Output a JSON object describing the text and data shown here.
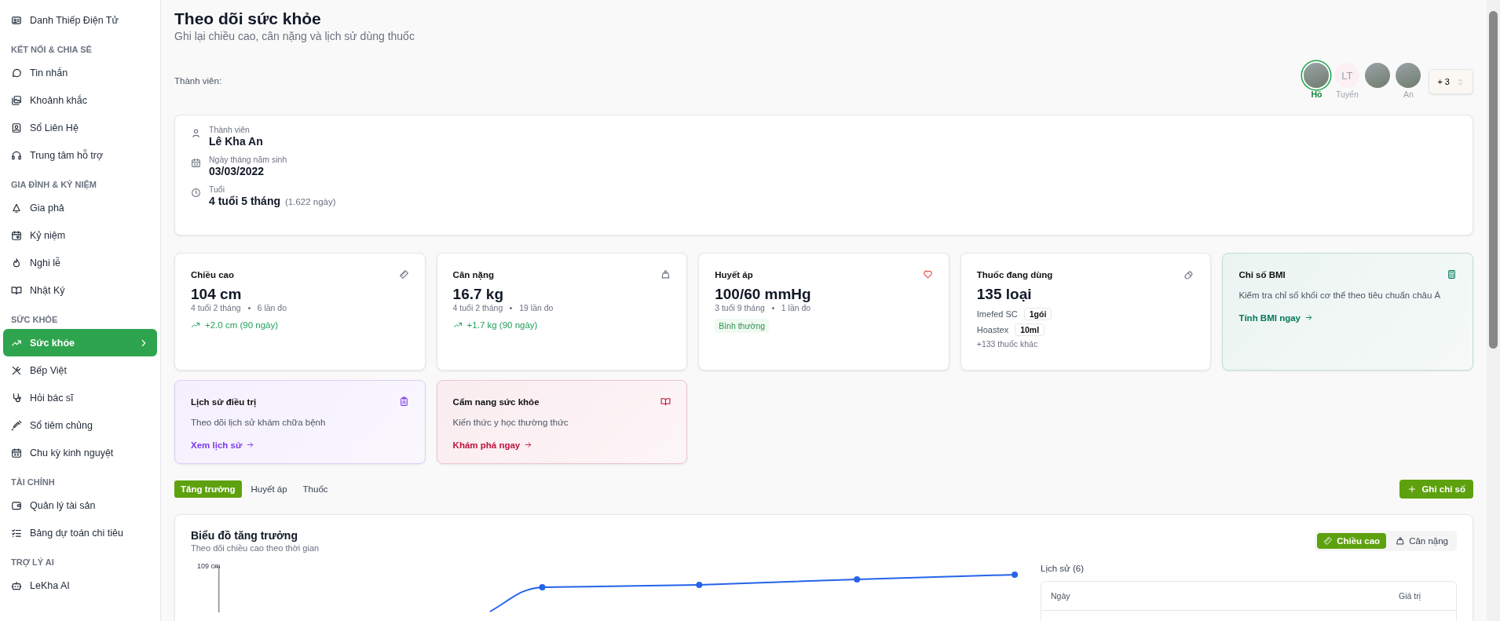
{
  "sidebar": {
    "sections": [
      {
        "items": [
          {
            "label": "Danh Thiếp Điện Tử",
            "selected": false
          }
        ]
      },
      {
        "title": "KẾT NỐI & CHIA SẺ",
        "items": [
          {
            "label": "Tin nhắn",
            "selected": false
          },
          {
            "label": "Khoảnh khắc",
            "selected": false
          },
          {
            "label": "Sổ Liên Hệ",
            "selected": false
          },
          {
            "label": "Trung tâm hỗ trợ",
            "selected": false
          }
        ]
      },
      {
        "title": "GIA ĐÌNH & KỶ NIỆM",
        "items": [
          {
            "label": "Gia phả",
            "selected": false
          },
          {
            "label": "Kỷ niệm",
            "selected": false
          },
          {
            "label": "Nghi lễ",
            "selected": false
          },
          {
            "label": "Nhật Ký",
            "selected": false
          }
        ]
      },
      {
        "title": "SỨC KHỎE",
        "items": [
          {
            "label": "Sức khỏe",
            "selected": true
          },
          {
            "label": "Bếp Việt",
            "selected": false
          },
          {
            "label": "Hỏi bác sĩ",
            "selected": false
          },
          {
            "label": "Sổ tiêm chủng",
            "selected": false
          },
          {
            "label": "Chu kỳ kinh nguyệt",
            "selected": false
          }
        ]
      },
      {
        "title": "TÀI CHÍNH",
        "items": [
          {
            "label": "Quản lý tài sản",
            "selected": false
          },
          {
            "label": "Bảng dự toán chi tiêu",
            "selected": false
          }
        ]
      },
      {
        "title": "TRỢ LÝ AI",
        "items": [
          {
            "label": "LeKha AI",
            "selected": false
          }
        ]
      }
    ]
  },
  "header": {
    "title": "Theo dõi sức khỏe",
    "subtitle": "Ghi lại chiều cao, cân nặng và lịch sử dùng thuốc"
  },
  "members": {
    "label": "Thành viên:",
    "items": [
      {
        "kind": "photo",
        "name": "Hồ",
        "selected": true
      },
      {
        "kind": "initials",
        "initials": "LT",
        "name": "Tuyến",
        "selected": false
      },
      {
        "kind": "photo",
        "selected": false
      },
      {
        "kind": "photo",
        "name": "An",
        "selected": false
      }
    ],
    "more": "+ 3"
  },
  "profile": [
    {
      "kind": "person",
      "label": "Thành viên",
      "value": "Lê Kha An"
    },
    {
      "kind": "date",
      "label": "Ngày tháng năm sinh",
      "value": "03/03/2022"
    },
    {
      "kind": "age",
      "label": "Tuổi",
      "value": "4 tuổi 5 tháng",
      "note": "(1.622 ngày)"
    }
  ],
  "cards": [
    {
      "kind": "measure",
      "title": "Chiều cao",
      "value": "104 cm",
      "age": "4 tuổi 2 tháng",
      "count": "6 lần đo",
      "trend": "+2.0 cm (90 ngày)"
    },
    {
      "kind": "measure",
      "title": "Cân nặng",
      "value": "16.7 kg",
      "age": "4 tuổi 2 tháng",
      "count": "19 lần đo",
      "trend": "+1.7 kg (90 ngày)"
    },
    {
      "kind": "status",
      "title": "Huyết áp",
      "value": "100/60 mmHg",
      "age": "3 tuổi 9 tháng",
      "count": "1 lần đo",
      "badge": "Bình thường"
    },
    {
      "kind": "medication",
      "title": "Thuốc đang dùng",
      "value": "135 loại",
      "meds": [
        {
          "name": "Imefed SC",
          "dose": "1gói"
        },
        {
          "name": "Hoastex",
          "dose": "10ml"
        }
      ],
      "more": "+133 thuốc khác"
    },
    {
      "kind": "link",
      "title": "Chỉ số BMI",
      "text": "Kiểm tra chỉ số khối cơ thể theo tiêu chuẩn châu Á",
      "link": "Tính BMI ngay",
      "color": "#047857"
    },
    {
      "kind": "link",
      "title": "Lịch sử điều trị",
      "text": "Theo dõi lịch sử khám chữa bệnh",
      "link": "Xem lịch sử",
      "color": "#7c3aed"
    },
    {
      "kind": "link",
      "title": "Cẩm nang sức khỏe",
      "text": "Kiến thức y học thường thức",
      "link": "Khám phá ngay",
      "color": "#be123c"
    }
  ],
  "tabs": [
    {
      "label": "Tăng trưởng",
      "selected": true
    },
    {
      "label": "Huyết áp",
      "selected": false
    },
    {
      "label": "Thuốc",
      "selected": false
    }
  ],
  "add_button": "Ghi chỉ số",
  "growth": {
    "title": "Biểu đồ tăng trưởng",
    "subtitle": "Theo dõi chiều cao theo thời gian",
    "toggles": [
      {
        "label": "Chiều cao",
        "selected": true
      },
      {
        "label": "Cân nặng",
        "selected": false
      }
    ],
    "y_label": "109 cm",
    "history": {
      "title": "Lịch sử (6)",
      "columns": [
        "Ngày",
        "Giá trị"
      ]
    }
  }
}
